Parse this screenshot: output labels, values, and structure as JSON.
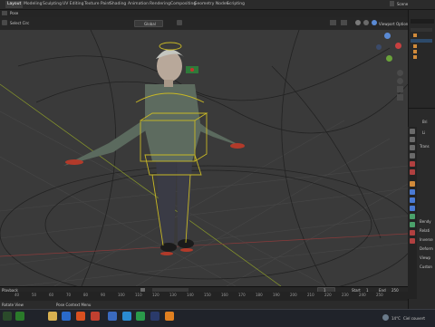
{
  "app": {
    "workspace_tabs": [
      "Layout",
      "Modeling",
      "Sculpting",
      "UV Editing",
      "Texture Paint",
      "Shading",
      "Animation",
      "Rendering",
      "Compositing",
      "Geometry Nodes",
      "Scripting"
    ],
    "active_tab": "Layout"
  },
  "viewport_header": {
    "mode": "Pose",
    "select_label": "Select Circ",
    "orientation": "Global",
    "viewport_options_label": "Viewport Options"
  },
  "outliner": {
    "search_placeholder": "",
    "header_label": "Scene"
  },
  "properties": {
    "letters": [
      "Bri",
      "Li",
      "Ra",
      "Pl",
      "De",
      "Ov",
      "Un",
      "Po",
      "Ex",
      "De",
      "Cu"
    ],
    "panel_labels": [
      "Trans",
      "Bendy",
      "Relati",
      "Inverse",
      "Deform",
      "Viewp",
      "Custon"
    ]
  },
  "timeline": {
    "playback_label": "Playback",
    "ruler_ticks": [
      "40",
      "50",
      "60",
      "70",
      "80",
      "90",
      "100",
      "110",
      "120",
      "130",
      "140",
      "150",
      "160",
      "170",
      "180",
      "190",
      "200",
      "210",
      "220",
      "230",
      "240",
      "250"
    ],
    "current_frame": "1",
    "start_label": "Start",
    "start_value": "1",
    "end_label": "End",
    "end_value": "250"
  },
  "status_bar": {
    "left_text": "Rotate View",
    "middle_text": "Pose Context Menu"
  },
  "taskbar": {
    "weather_temp": "14°C",
    "weather_text": "Ciel couvert"
  },
  "colors": {
    "viewport_bg": "#3a3a3a",
    "armature_yellow": "#c8b825",
    "axis_red": "#9a3a3a",
    "axis_green": "#6a8a2a"
  }
}
